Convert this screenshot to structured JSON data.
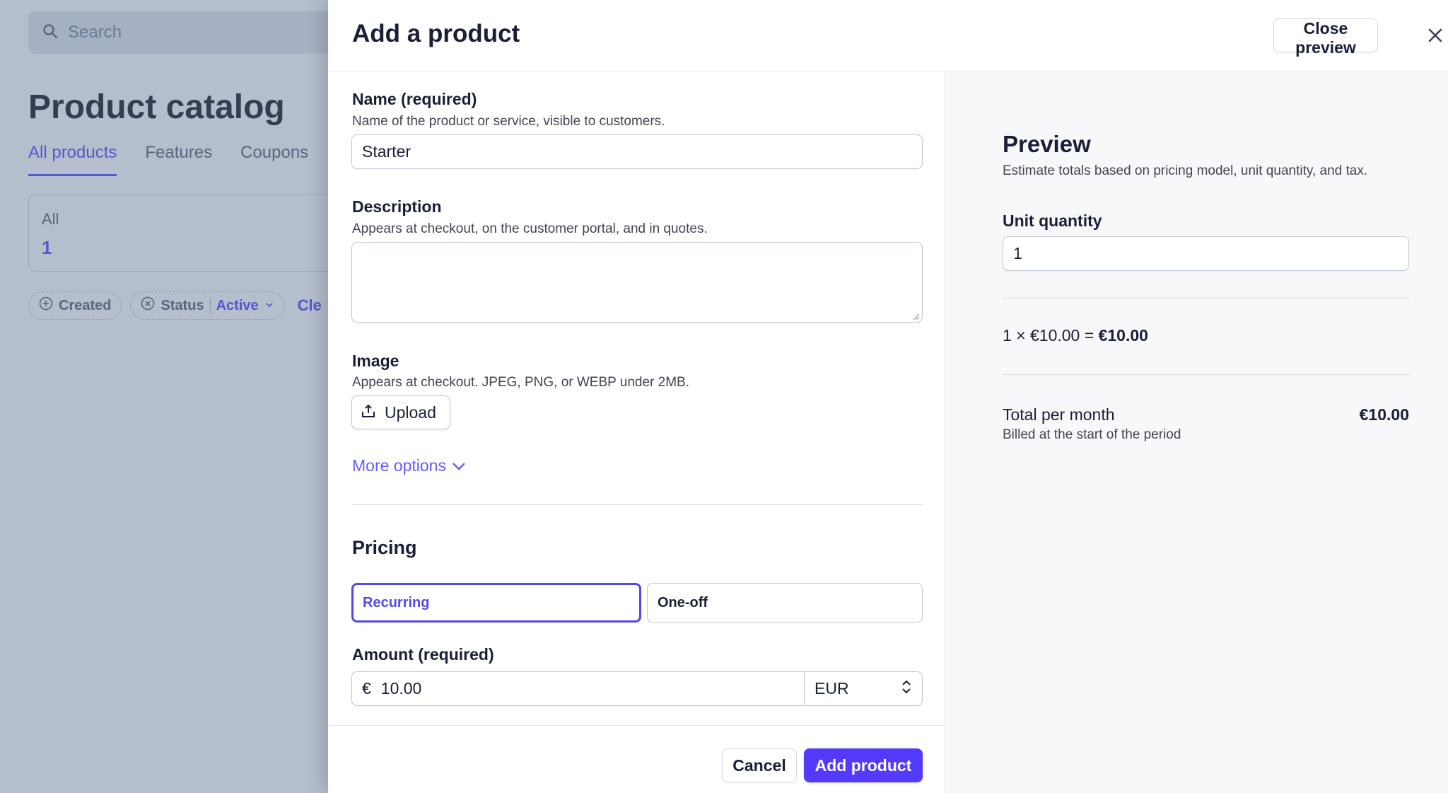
{
  "background": {
    "search_placeholder": "Search",
    "page_title": "Product catalog",
    "tabs": [
      {
        "label": "All products"
      },
      {
        "label": "Features"
      },
      {
        "label": "Coupons"
      }
    ],
    "summary_card": {
      "label": "All",
      "value": "1"
    },
    "filters": {
      "created_label": "Created",
      "status_label": "Status",
      "status_value": "Active",
      "clear_label": "Cle"
    }
  },
  "drawer": {
    "title": "Add a product",
    "close_preview_label": "Close preview"
  },
  "form": {
    "name": {
      "label": "Name (required)",
      "help": "Name of the product or service, visible to customers.",
      "value": "Starter"
    },
    "description": {
      "label": "Description",
      "help": "Appears at checkout, on the customer portal, and in quotes.",
      "value": ""
    },
    "image": {
      "label": "Image",
      "help": "Appears at checkout. JPEG, PNG, or WEBP under 2MB.",
      "upload_label": "Upload"
    },
    "more_options_label": "More options",
    "pricing": {
      "title": "Pricing",
      "recurring_label": "Recurring",
      "oneoff_label": "One-off",
      "selected": "Recurring",
      "amount_label": "Amount (required)",
      "currency_symbol": "€",
      "amount_value": "10.00",
      "currency": "EUR"
    }
  },
  "footer": {
    "cancel_label": "Cancel",
    "add_label": "Add product"
  },
  "preview": {
    "title": "Preview",
    "subtitle": "Estimate totals based on pricing model, unit quantity, and tax.",
    "unit_quantity_label": "Unit quantity",
    "unit_quantity_value": "1",
    "calc_expression": "1 × €10.00 = ",
    "calc_result": "€10.00",
    "total_label": "Total per month",
    "total_value": "€10.00",
    "billed_note": "Billed at the start of the period"
  },
  "colors": {
    "accent": "#635bff",
    "primary_button": "#533afd",
    "text": "#1a1f36"
  },
  "icons": [
    "search-icon",
    "close-icon",
    "upload-icon",
    "chevron-down-icon",
    "plus-circle-icon",
    "x-circle-icon",
    "select-arrows-icon"
  ]
}
